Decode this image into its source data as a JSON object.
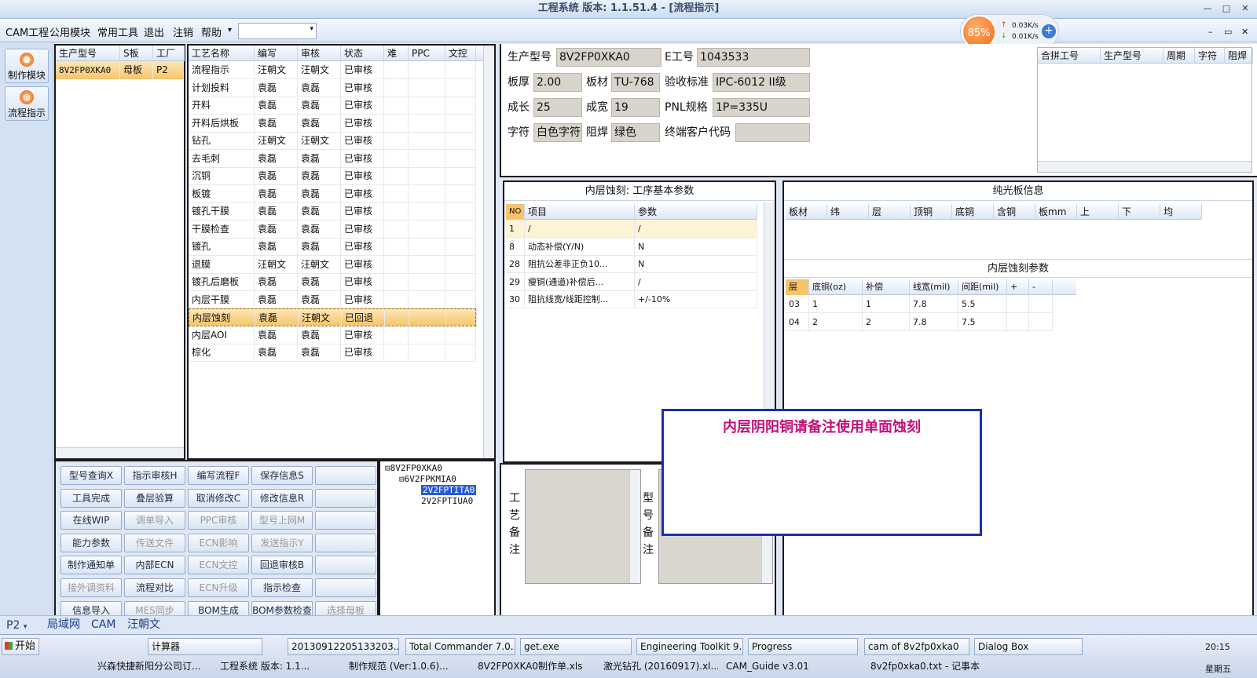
{
  "window": {
    "title": "工程系统  版本: 1.1.51.4 - [流程指示]",
    "min": "—",
    "restore": "□",
    "close": "✕"
  },
  "menubar": {
    "items": [
      "CAM工程",
      "公用模块",
      "常用工具",
      "退出",
      "注销",
      "帮助"
    ],
    "arrow": "▾",
    "combo_value": "",
    "right_controls": [
      "–",
      "▭",
      "✕"
    ]
  },
  "netmon": {
    "percent": "85%",
    "up": "0.03K/s",
    "down": "0.01K/s",
    "up_arrow": "↑",
    "down_arrow": "↓",
    "plus": "+"
  },
  "sidebar": {
    "items": [
      {
        "label": "制作模块"
      },
      {
        "label": "流程指示"
      }
    ]
  },
  "model_list": {
    "headers": [
      "生产型号",
      "S板",
      "工厂"
    ],
    "rows": [
      [
        "8V2FP0XKA0",
        "母板",
        "P2"
      ]
    ]
  },
  "process_table": {
    "headers": [
      "工艺名称",
      "编写",
      "审核",
      "状态",
      "难",
      "PPC",
      "文控"
    ],
    "rows": [
      [
        "流程指示",
        "汪朝文",
        "汪朝文",
        "已审核"
      ],
      [
        "计划投料",
        "袁磊",
        "袁磊",
        "已审核"
      ],
      [
        "开料",
        "袁磊",
        "袁磊",
        "已审核"
      ],
      [
        "开料后烘板",
        "袁磊",
        "袁磊",
        "已审核"
      ],
      [
        "钻孔",
        "汪朝文",
        "汪朝文",
        "已审核"
      ],
      [
        "去毛刺",
        "袁磊",
        "袁磊",
        "已审核"
      ],
      [
        "沉铜",
        "袁磊",
        "袁磊",
        "已审核"
      ],
      [
        "板镀",
        "袁磊",
        "袁磊",
        "已审核"
      ],
      [
        "镀孔干膜",
        "袁磊",
        "袁磊",
        "已审核"
      ],
      [
        "干膜检查",
        "袁磊",
        "袁磊",
        "已审核"
      ],
      [
        "镀孔",
        "袁磊",
        "袁磊",
        "已审核"
      ],
      [
        "退膜",
        "汪朝文",
        "汪朝文",
        "已审核"
      ],
      [
        "镀孔后磨板",
        "袁磊",
        "袁磊",
        "已审核"
      ],
      [
        "内层干膜",
        "袁磊",
        "袁磊",
        "已审核"
      ],
      [
        "内层蚀刻",
        "袁磊",
        "汪朝文",
        "已回退"
      ],
      [
        "内层AOI",
        "袁磊",
        "袁磊",
        "已审核"
      ],
      [
        "棕化",
        "袁磊",
        "袁磊",
        "已审核"
      ]
    ],
    "selected_index": 14
  },
  "buttons": [
    [
      "型号查询X",
      "指示审核H",
      "编写流程F",
      "保存信息S",
      ""
    ],
    [
      "工具完成",
      "叠层验算",
      "取消修改C",
      "修改信息R",
      ""
    ],
    [
      "在线WIP",
      "调单导入",
      "PPC审核",
      "型号上网M",
      ""
    ],
    [
      "能力参数",
      "传送文件",
      "ECN影响",
      "发送指示Y",
      ""
    ],
    [
      "制作通知单",
      "内部ECN",
      "ECN文控",
      "回退审核B",
      ""
    ],
    [
      "接外调资料",
      "流程对比",
      "ECN升级",
      "指示检查",
      ""
    ],
    [
      "信息导入",
      "MES同步",
      "BOM生成",
      "BOM参数检查",
      "选择母板"
    ]
  ],
  "disabled_buttons": [
    "调单导入",
    "PPC审核",
    "型号上网M",
    "传送文件",
    "ECN影响",
    "发送指示Y",
    "ECN文控",
    "接外调资料",
    "ECN升级",
    "MES同步",
    "选择母板"
  ],
  "tree": {
    "root": "8V2FP0XKA0",
    "child": "6V2FPKMIA0",
    "leaves": [
      "2V2FPTITA0",
      "2V2FPTIUA0"
    ],
    "minus": "⊟"
  },
  "info": {
    "model_label": "生产型号",
    "model": "8V2FP0XKA0",
    "e_label": "E工号",
    "e": "1043533",
    "thick_label": "板厚",
    "thick": "2.00",
    "mat_label": "板材",
    "mat": "TU-768",
    "std_label": "验收标准",
    "std": "IPC-6012 II级",
    "len_label": "成长",
    "len": "25",
    "wid_label": "成宽",
    "wid": "19",
    "pnl_label": "PNL规格",
    "pnl": "1P=335U",
    "char_label": "字符",
    "char": "白色字符",
    "mask_label": "阻焊",
    "mask": "绿色",
    "cust_label": "终端客户代码",
    "cust": ""
  },
  "merge_table": {
    "headers": [
      "合拼工号",
      "生产型号",
      "周期",
      "字符",
      "阻焊"
    ]
  },
  "etch_basic": {
    "title": "内层蚀刻: 工序基本参数",
    "headers": [
      "NO",
      "项目",
      "参数"
    ],
    "rows": [
      [
        "1",
        "/",
        "/"
      ],
      [
        "8",
        "动态补偿(Y/N)",
        "N"
      ],
      [
        "28",
        "阻抗公差非正负10...",
        "N"
      ],
      [
        "29",
        "瘦铜(通道)补偿后...",
        "/"
      ],
      [
        "30",
        "阻抗线宽/线距控制...",
        "+/-10%"
      ]
    ]
  },
  "bare_board": {
    "title": "纯光板信息",
    "headers": [
      "板材",
      "纬",
      "层",
      "顶铜",
      "底铜",
      "含铜",
      "板mm",
      "上",
      "下",
      "均"
    ]
  },
  "etch_params": {
    "title": "内层蚀刻参数",
    "headers": [
      "层",
      "底铜(oz)",
      "补偿",
      "线宽(mil)",
      "间距(mil)",
      "+",
      "-"
    ],
    "rows": [
      [
        "03",
        "1",
        "1",
        "7.8",
        "5.5",
        "",
        ""
      ],
      [
        "04",
        "2",
        "2",
        "7.8",
        "7.5",
        "",
        ""
      ]
    ]
  },
  "notes": {
    "process_label": "工艺备注",
    "model_label": "型号备注"
  },
  "dialog": {
    "text": "内层阴阳铜请备注使用单面蚀刻"
  },
  "status": {
    "plant": "P2",
    "tabs": [
      "局域网",
      "CAM",
      "汪朝文"
    ]
  },
  "taskbar": {
    "start": "开始",
    "row1": [
      "计算器",
      "20130912205133203...",
      "Total Commander 7.0...",
      "get.exe",
      "Engineering Toolkit 9....",
      "Progress",
      "cam of 8v2fp0xka0",
      "Dialog Box"
    ],
    "row2": [
      "兴森快捷新阳分公司订...",
      "工程系统  版本: 1.1...",
      "制作规范 (Ver:1.0.6)...",
      "8V2FP0XKA0制作单.xls",
      "激光钻孔 (20160917).xl...",
      "CAM_Guide v3.01",
      "8v2fp0xka0.txt - 记事本"
    ],
    "time": "20:15",
    "day": "星期五"
  },
  "colors": {
    "accent": "#1a2db8",
    "dialog_text": "#c0107a",
    "selected_row": "#f7c46a"
  }
}
